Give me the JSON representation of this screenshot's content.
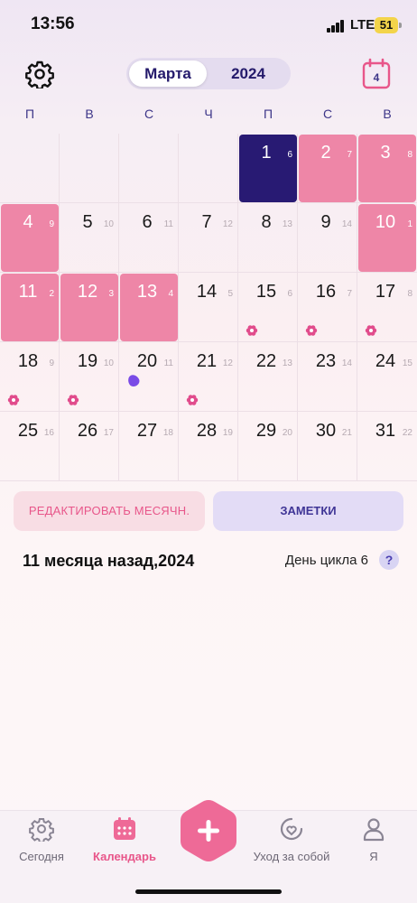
{
  "status_bar": {
    "time": "13:56",
    "network": "LTE",
    "battery": "51"
  },
  "header": {
    "month_label": "Марта",
    "year_label": "2024",
    "today_day": "4",
    "icons": {
      "settings": "gear-icon",
      "today": "calendar-today-icon"
    }
  },
  "weekdays": [
    "П",
    "В",
    "С",
    "Ч",
    "П",
    "С",
    "В"
  ],
  "calendar": {
    "colors": {
      "period": "#ee86a7",
      "today": "#281a73",
      "fertile": "#e14c8c",
      "ovulation": "#7a4be6"
    },
    "weeks": [
      [
        {
          "day": "",
          "cycle": "",
          "state": "empty"
        },
        {
          "day": "",
          "cycle": "",
          "state": "empty"
        },
        {
          "day": "",
          "cycle": "",
          "state": "empty"
        },
        {
          "day": "",
          "cycle": "",
          "state": "empty"
        },
        {
          "day": "1",
          "cycle": "6",
          "state": "selected"
        },
        {
          "day": "2",
          "cycle": "7",
          "state": "period"
        },
        {
          "day": "3",
          "cycle": "8",
          "state": "period"
        }
      ],
      [
        {
          "day": "4",
          "cycle": "9",
          "state": "period"
        },
        {
          "day": "5",
          "cycle": "10",
          "state": "normal"
        },
        {
          "day": "6",
          "cycle": "11",
          "state": "normal"
        },
        {
          "day": "7",
          "cycle": "12",
          "state": "normal"
        },
        {
          "day": "8",
          "cycle": "13",
          "state": "normal"
        },
        {
          "day": "9",
          "cycle": "14",
          "state": "normal"
        },
        {
          "day": "10",
          "cycle": "1",
          "state": "period"
        }
      ],
      [
        {
          "day": "11",
          "cycle": "2",
          "state": "period"
        },
        {
          "day": "12",
          "cycle": "3",
          "state": "period"
        },
        {
          "day": "13",
          "cycle": "4",
          "state": "period"
        },
        {
          "day": "14",
          "cycle": "5",
          "state": "normal"
        },
        {
          "day": "15",
          "cycle": "6",
          "state": "fertile"
        },
        {
          "day": "16",
          "cycle": "7",
          "state": "fertile"
        },
        {
          "day": "17",
          "cycle": "8",
          "state": "fertile"
        }
      ],
      [
        {
          "day": "18",
          "cycle": "9",
          "state": "fertile"
        },
        {
          "day": "19",
          "cycle": "10",
          "state": "fertile"
        },
        {
          "day": "20",
          "cycle": "11",
          "state": "ovulation"
        },
        {
          "day": "21",
          "cycle": "12",
          "state": "fertile"
        },
        {
          "day": "22",
          "cycle": "13",
          "state": "normal"
        },
        {
          "day": "23",
          "cycle": "14",
          "state": "normal"
        },
        {
          "day": "24",
          "cycle": "15",
          "state": "normal"
        }
      ],
      [
        {
          "day": "25",
          "cycle": "16",
          "state": "normal"
        },
        {
          "day": "26",
          "cycle": "17",
          "state": "normal"
        },
        {
          "day": "27",
          "cycle": "18",
          "state": "normal"
        },
        {
          "day": "28",
          "cycle": "19",
          "state": "normal"
        },
        {
          "day": "29",
          "cycle": "20",
          "state": "normal"
        },
        {
          "day": "30",
          "cycle": "21",
          "state": "normal"
        },
        {
          "day": "31",
          "cycle": "22",
          "state": "normal"
        }
      ]
    ]
  },
  "actions": {
    "edit_label": "РЕДАКТИРОВАТЬ МЕСЯЧН.",
    "notes_label": "ЗАМЕТКИ"
  },
  "info": {
    "date_text": "11 месяца назад,2024",
    "cycle_day_text": "День цикла 6",
    "help_label": "?"
  },
  "tabbar": {
    "tabs": [
      {
        "label": "Сегодня",
        "icon": "gear-flower-icon",
        "active": false
      },
      {
        "label": "Календарь",
        "icon": "calendar-icon",
        "active": true
      },
      {
        "label": "Уход за собой",
        "icon": "heart-circle-icon",
        "active": false
      },
      {
        "label": "Я",
        "icon": "person-icon",
        "active": false
      }
    ],
    "fab_icon": "plus-icon"
  }
}
